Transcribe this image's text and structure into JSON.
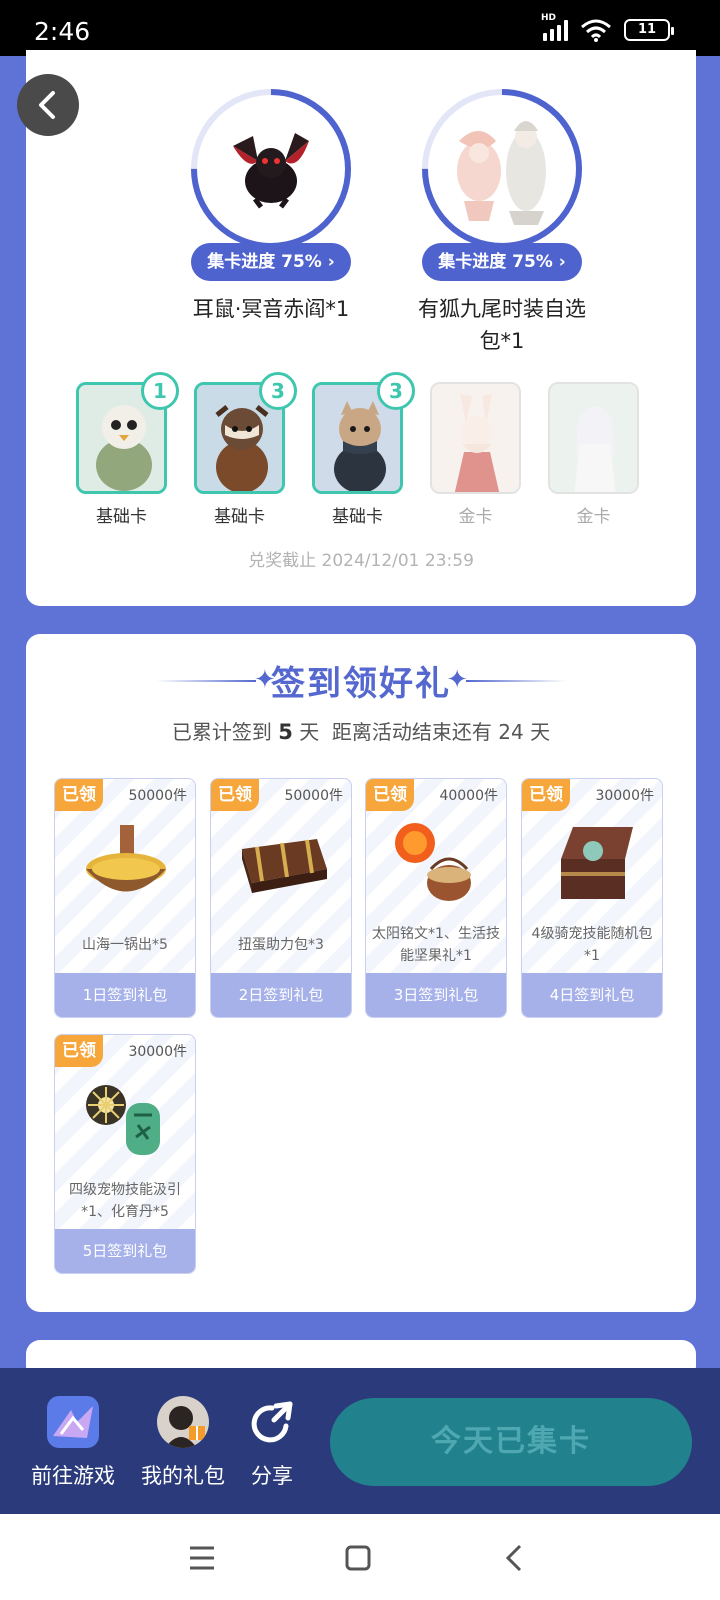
{
  "status_bar": {
    "time": "2:46",
    "battery": "11"
  },
  "rewards": [
    {
      "progress_label": "集卡进度 75%",
      "progress": 0.75,
      "name": "耳鼠·冥音赤阎*1"
    },
    {
      "progress_label": "集卡进度 75%",
      "progress": 0.75,
      "name": "有狐九尾时装自选包*1"
    }
  ],
  "cards": [
    {
      "count": "1",
      "label": "基础卡",
      "collected": true
    },
    {
      "count": "3",
      "label": "基础卡",
      "collected": true
    },
    {
      "count": "3",
      "label": "基础卡",
      "collected": true
    },
    {
      "count": "",
      "label": "金卡",
      "collected": false
    },
    {
      "count": "",
      "label": "金卡",
      "collected": false
    }
  ],
  "deadline": "兑奖截止 2024/12/01 23:59",
  "sign": {
    "title": "签到领好礼",
    "sub_prefix": "已累计签到",
    "days_signed": "5",
    "sub_mid": "天  距离活动结束还有",
    "days_left": "24",
    "sub_suffix": "天"
  },
  "gifts": [
    {
      "tag": "已领",
      "qty": "50000件",
      "name": "山海一锅出*5",
      "day": "1日签到礼包"
    },
    {
      "tag": "已领",
      "qty": "50000件",
      "name": "扭蛋助力包*3",
      "day": "2日签到礼包"
    },
    {
      "tag": "已领",
      "qty": "40000件",
      "name": "太阳铭文*1、生活技能坚果礼*1",
      "day": "3日签到礼包"
    },
    {
      "tag": "已领",
      "qty": "30000件",
      "name": "4级骑宠技能随机包*1",
      "day": "4日签到礼包"
    },
    {
      "tag": "已领",
      "qty": "30000件",
      "name": "四级宠物技能汲引*1、化育丹*5",
      "day": "5日签到礼包"
    }
  ],
  "bottom_bar": {
    "go_game": "前往游戏",
    "my_gifts": "我的礼包",
    "share": "分享",
    "today_button": "今天已集卡"
  },
  "colors": {
    "accent": "#5468cf",
    "card_border": "#3ec7ae",
    "tag": "#f6a63a",
    "background": "#5f73d6"
  }
}
